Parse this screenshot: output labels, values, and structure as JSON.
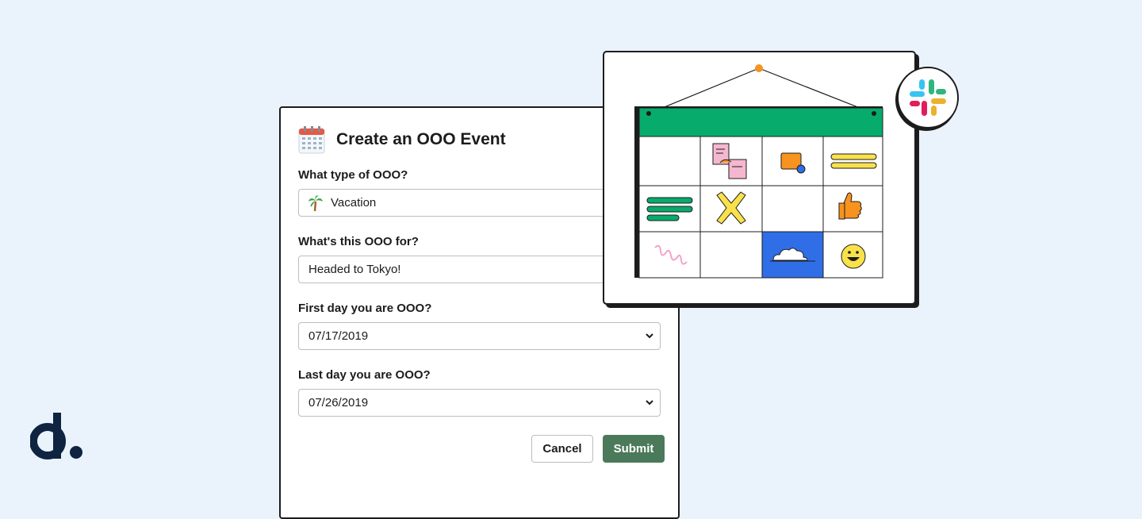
{
  "modal": {
    "title": "Create an OOO Event",
    "icon": "calendar-icon",
    "fields": [
      {
        "label": "What type of OOO?",
        "value": "Vacation",
        "icon": "palm-tree-icon",
        "kind": "select"
      },
      {
        "label": "What's this OOO for?",
        "value": "Headed to Tokyo!",
        "kind": "text"
      },
      {
        "label": "First day you are OOO?",
        "value": "07/17/2019",
        "kind": "date"
      },
      {
        "label": "Last day you are OOO?",
        "value": "07/26/2019",
        "kind": "date"
      }
    ],
    "buttons": {
      "cancel": "Cancel",
      "submit": "Submit"
    }
  },
  "colors": {
    "background": "#eaf3fc",
    "submit": "#4a7a5a",
    "calendar_header": "#07ab6b",
    "cell_highlight": "#2f6ee6",
    "brand": "#0e2440"
  },
  "illustration": {
    "type": "wall-calendar",
    "cells": [
      "empty",
      "sticky-notes-icon",
      "shapes-icon",
      "yellow-lines-icon",
      "green-lines-icon",
      "x-mark-icon",
      "empty",
      "thumbs-up-icon",
      "squiggle-icon",
      "empty",
      "cloud-icon",
      "smiley-icon"
    ]
  },
  "badges": {
    "app": "slack-logo-icon",
    "brand": "brand-logo-icon"
  }
}
